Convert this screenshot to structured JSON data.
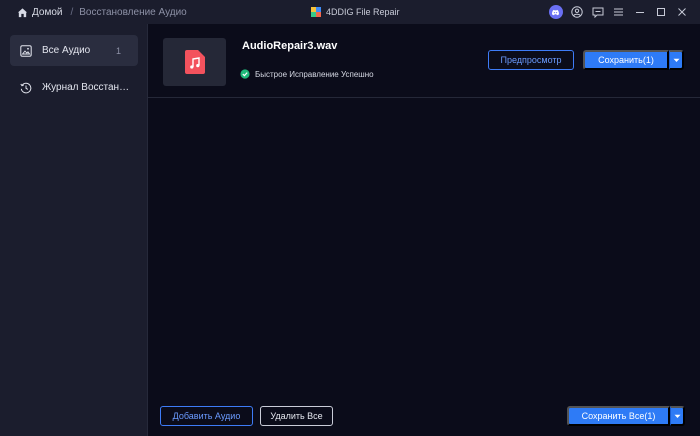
{
  "breadcrumb": {
    "home": "Домой",
    "separator": "/",
    "current": "Восстановление Аудио"
  },
  "app": {
    "title": "4DDIG File Repair"
  },
  "titlebar_icons": [
    "discord-icon",
    "user-icon",
    "feedback-icon",
    "menu-icon",
    "minimize-icon",
    "maximize-icon",
    "close-icon"
  ],
  "sidebar": {
    "items": [
      {
        "label": "Все Аудио",
        "count": "1",
        "icon": "audio-image-icon"
      },
      {
        "label": "Журнал Восстановления",
        "icon": "history-icon"
      }
    ]
  },
  "file": {
    "name": "AudioRepair3.wav",
    "status": "Быстрое Исправление Успешно",
    "preview_label": "Предпросмотр",
    "save_label": "Сохранить(1)"
  },
  "footer": {
    "add_label": "Добавить Аудио",
    "delete_label": "Удалить Все",
    "save_all_label": "Сохранить Все(1)"
  },
  "colors": {
    "accent": "#2e7bf6",
    "success": "#1fb97a",
    "file_icon": "#f3525d",
    "background": "#0b0c1a",
    "panel": "#1b1d2d"
  }
}
